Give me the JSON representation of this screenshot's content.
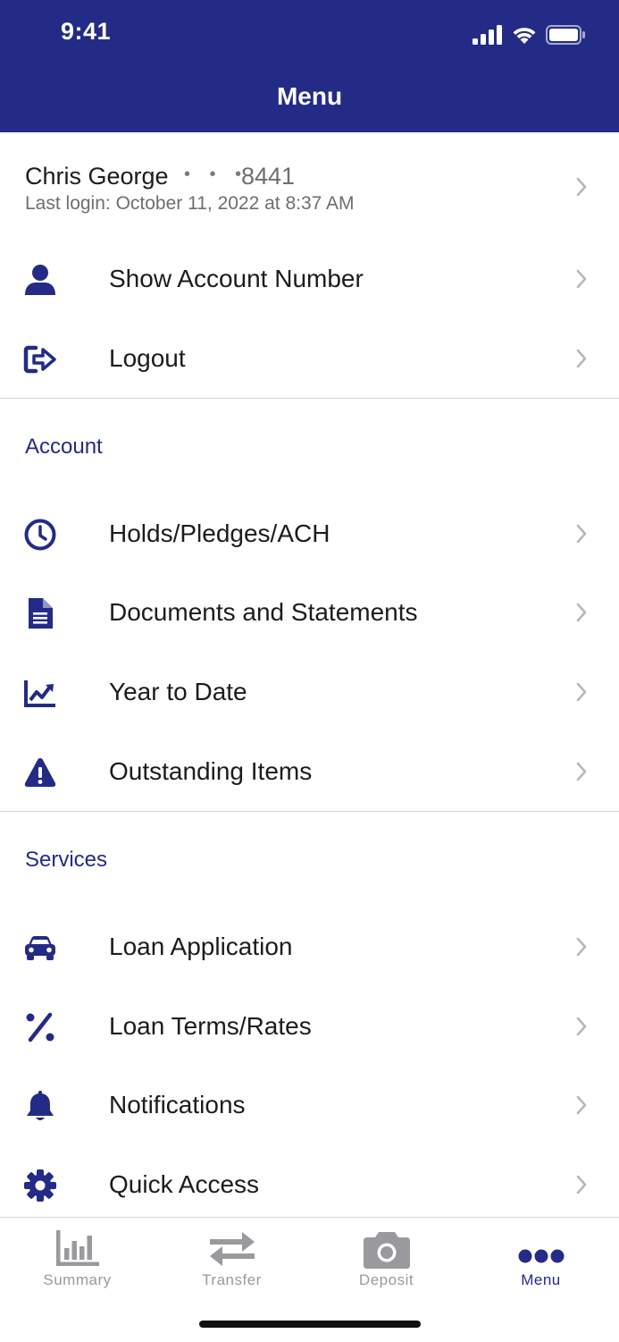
{
  "status_bar": {
    "time": "9:41"
  },
  "header": {
    "title": "Menu"
  },
  "user": {
    "name": "Chris George",
    "masked_dots": "• • •",
    "account_suffix": "8441",
    "last_login": "Last login: October 11, 2022 at 8:37 AM"
  },
  "profile_items": [
    {
      "label": "Show Account Number",
      "icon": "user-icon"
    },
    {
      "label": "Logout",
      "icon": "logout-icon"
    }
  ],
  "account_section": {
    "title": "Account",
    "items": [
      {
        "label": "Holds/Pledges/ACH",
        "icon": "clock-icon"
      },
      {
        "label": "Documents and Statements",
        "icon": "document-icon"
      },
      {
        "label": "Year to Date",
        "icon": "chart-line-icon"
      },
      {
        "label": "Outstanding Items",
        "icon": "warning-icon"
      }
    ]
  },
  "services_section": {
    "title": "Services",
    "items": [
      {
        "label": "Loan Application",
        "icon": "car-icon"
      },
      {
        "label": "Loan Terms/Rates",
        "icon": "percent-icon"
      },
      {
        "label": "Notifications",
        "icon": "bell-icon"
      },
      {
        "label": "Quick Access",
        "icon": "gear-icon"
      }
    ]
  },
  "tab_bar": {
    "tabs": [
      {
        "label": "Summary",
        "icon": "bar-chart-icon",
        "active": false
      },
      {
        "label": "Transfer",
        "icon": "transfer-icon",
        "active": false
      },
      {
        "label": "Deposit",
        "icon": "camera-icon",
        "active": false
      },
      {
        "label": "Menu",
        "icon": "more-icon",
        "active": true
      }
    ]
  },
  "colors": {
    "brand": "#232b86",
    "inactive_tab": "#9a9a9e",
    "divider": "#d4d4d8",
    "chevron": "#b8b8bc"
  }
}
